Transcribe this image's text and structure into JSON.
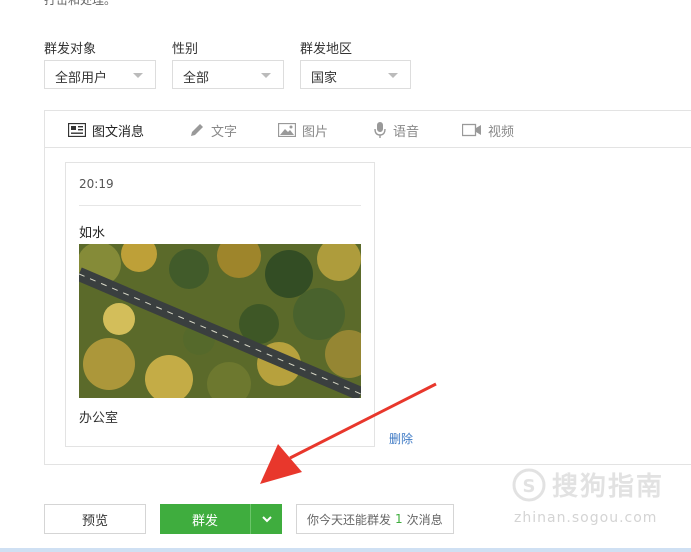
{
  "top_note": "打击和处理。",
  "filters": {
    "target": {
      "label": "群发对象",
      "value": "全部用户"
    },
    "gender": {
      "label": "性别",
      "value": "全部"
    },
    "region": {
      "label": "群发地区",
      "value": "国家"
    }
  },
  "tabs": [
    {
      "label": "图文消息",
      "icon": "news-icon"
    },
    {
      "label": "文字",
      "icon": "pencil-icon"
    },
    {
      "label": "图片",
      "icon": "image-icon"
    },
    {
      "label": "语音",
      "icon": "microphone-icon"
    },
    {
      "label": "视频",
      "icon": "video-icon"
    }
  ],
  "card": {
    "time": "20:19",
    "title": "如水",
    "footer": "办公室",
    "delete_label": "删除"
  },
  "actions": {
    "preview_label": "预览",
    "send_label": "群发",
    "quota_prefix": "你今天还能群发",
    "quota_count": "1",
    "quota_suffix": "次消息"
  },
  "watermark": {
    "text": "搜狗指南",
    "url": "zhinan.sogou.com"
  },
  "colors": {
    "accent_green": "#3fad3e",
    "link_blue": "#3d79c4",
    "arrow_red": "#e8372c"
  }
}
